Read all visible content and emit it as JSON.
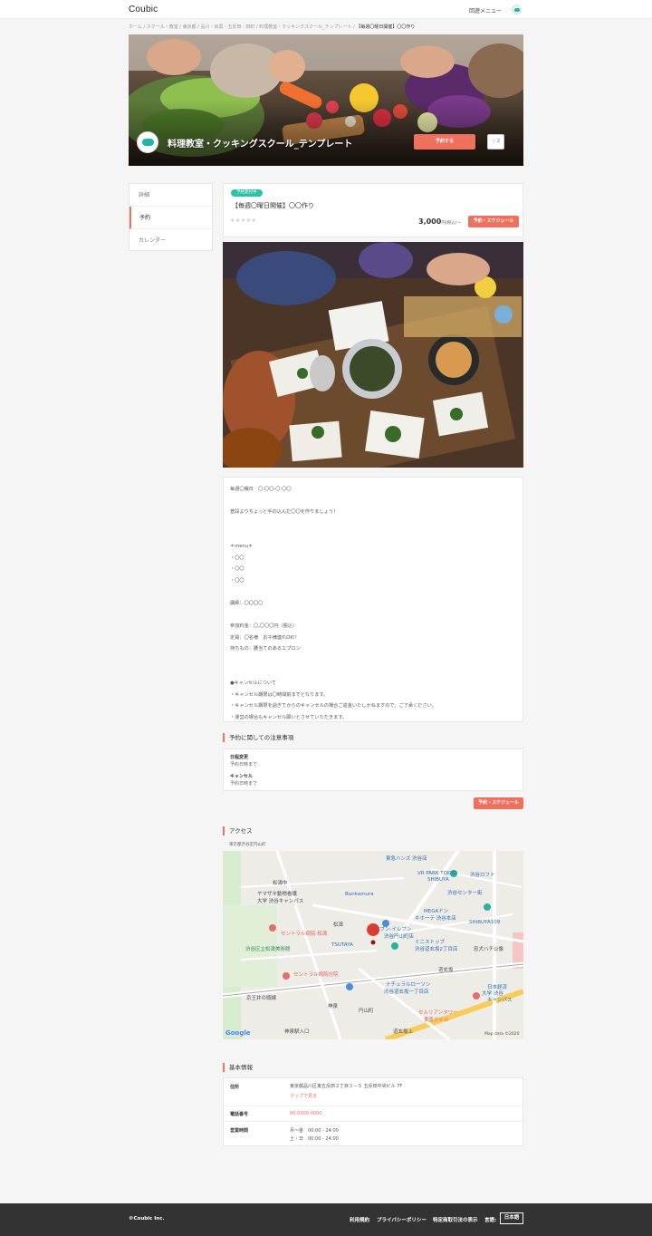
{
  "header": {
    "logo": "Coubic",
    "menu_label": "回遊メニュー"
  },
  "breadcrumb": {
    "path": "ホーム / スクール・教室 / 東京都 / 品川・目黒・五反田・田町 / 料理教室・クッキングスクール_テンプレート /",
    "current": "【毎週〇曜日開催】〇〇作り"
  },
  "hero": {
    "title": "料理教室・クッキングスクール_テンプレート",
    "reserve_label": "予約する",
    "fav_count": "♡ 2"
  },
  "sidebar": {
    "items": [
      {
        "label": "詳細"
      },
      {
        "label": "予約"
      },
      {
        "label": "カレンダー"
      }
    ]
  },
  "plan": {
    "badge": "予約受付中",
    "title": "【毎週〇曜日開催】〇〇作り",
    "stars": "★★★★★",
    "price": "3,000",
    "price_unit": "円(税込)〜",
    "schedule_label": "予約・スケジュール"
  },
  "description": {
    "lines": [
      "毎週〇曜日　〇:〇〇-〇:〇〇",
      "",
      "普段よりちょっと手の込んだ〇〇を作りましょう！",
      "",
      "",
      "＊menu＊",
      "・〇〇",
      "・〇〇",
      "・〇〇",
      "",
      "講師：〇〇〇〇",
      "",
      "参加料金：〇,〇〇〇円（税込）",
      "定員：〇名様　お子様連れOK!!",
      "持ちもの：腰当てのあるエプロン",
      "",
      "",
      "●キャンセルについて",
      "・キャンセル期限は〇時間前までとなります。",
      "・キャンセル期限を過ぎてからのキャンセルの場合ご返金いたしかねますので、ご了承ください。",
      "・運営の場合もキャンセル願いとさせていただきます。"
    ]
  },
  "notes": {
    "heading": "予約に関しての注意事項",
    "items": [
      {
        "key": "日程変更",
        "value": "予約日時まで"
      },
      {
        "key": "キャンセル",
        "value": "予約日時まで"
      }
    ],
    "schedule_label": "予約・スケジュール"
  },
  "access": {
    "heading": "アクセス",
    "address": "東京都渋谷区円山町",
    "map_labels": [
      "東急ハンズ 渋谷店",
      "松濤中",
      "VR PARK TOKYO",
      "SHIBUYA",
      "渋谷ロフト",
      "ヤマザキ動物看護",
      "大学 渋谷キャンパス",
      "Bunkamura",
      "渋谷センター街",
      "MEGAドン",
      "キホーテ 渋谷本店",
      "SHIBUYA109",
      "セントラル病院 松濤",
      "セブン-イレブン",
      "渋谷円山町店",
      "渋谷区立松濤美術館",
      "TSUTAYA",
      "ミニストップ",
      "渋谷道玄坂2丁目店",
      "忠犬ハチ公像",
      "セントラル病院分院",
      "ナチュラルローソン",
      "渋谷道玄坂一丁目店",
      "日本経済",
      "大学 渋谷",
      "キャンパス",
      "京王井の頭線",
      "神泉",
      "円山町",
      "セルリアンタワー",
      "東急ホテル",
      "道玄坂上",
      "神泉駅入口",
      "松濤",
      "道玄坂",
      "Google",
      "Map data ©2020"
    ]
  },
  "basic_info": {
    "heading": "基本情報",
    "rows": [
      {
        "key": "住所",
        "value": "東京都品川区東五反田２丁目３－５ 五反田中央ビル 7F",
        "link": "マップで見る"
      },
      {
        "key": "電話番号",
        "value": "00-0000-0000"
      },
      {
        "key": "営業時間",
        "value": "月～金　00:00 - 24:00",
        "value2": "土・日　00:00 - 24:00"
      }
    ]
  },
  "footer": {
    "copyright": "©Coubic Inc.",
    "links": [
      "利用規約",
      "プライバシーポリシー",
      "特定商取引法の表示"
    ],
    "lang_label": "言語:",
    "lang_value": "日本語"
  },
  "colors": {
    "accent": "#f0705e",
    "brand": "#1fb5ad",
    "badge": "#2cc4a8"
  }
}
